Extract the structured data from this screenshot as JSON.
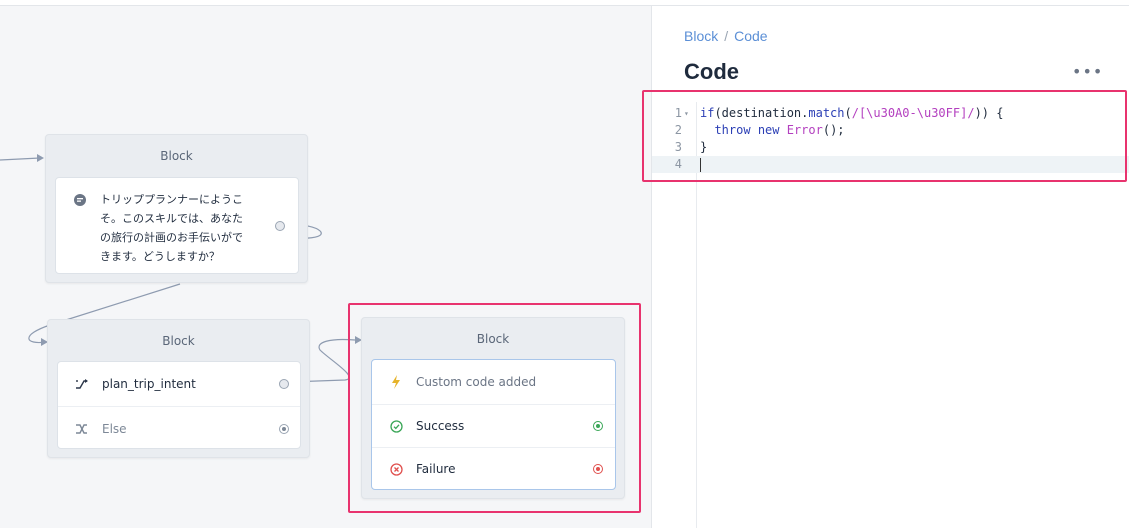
{
  "canvas": {
    "block_greeting": {
      "title": "Block",
      "message": [
        "トリッププランナーにようこ",
        "そ。このスキルでは、あなた",
        "の旅行の計画のお手伝いがで",
        "きます。どうしますか？"
      ]
    },
    "block_intent": {
      "title": "Block",
      "rows": [
        {
          "label": "plan_trip_intent",
          "icon": "shuffle-arrow-icon"
        },
        {
          "label": "Else",
          "icon": "shuffle-x-icon"
        }
      ]
    },
    "block_code": {
      "title": "Block",
      "header_row": "Custom code added",
      "success": "Success",
      "failure": "Failure"
    },
    "colors": {
      "highlight": "#e8336e",
      "success": "#3aa657",
      "failure": "#e0504e",
      "bolt": "#e6b32a",
      "link": "#5b8fd6"
    }
  },
  "panel": {
    "breadcrumb": {
      "parent": "Block",
      "separator": "/",
      "current": "Code"
    },
    "title": "Code",
    "more_label": "•••",
    "editor": {
      "line_numbers": [
        "1",
        "2",
        "3",
        "4"
      ]
    }
  }
}
